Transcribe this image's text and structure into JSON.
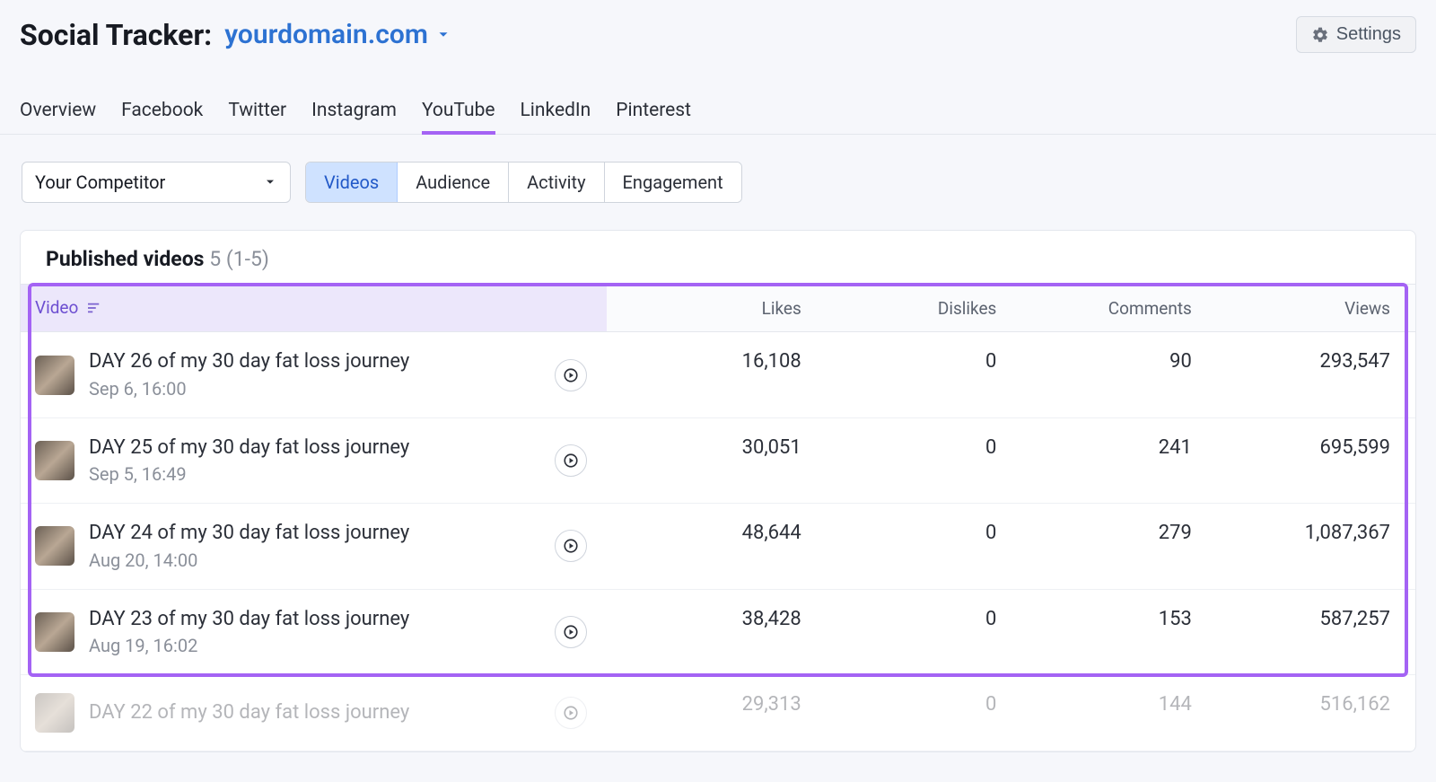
{
  "header": {
    "title_prefix": "Social Tracker:",
    "domain": "yourdomain.com",
    "settings_label": "Settings"
  },
  "tabs": {
    "items": [
      "Overview",
      "Facebook",
      "Twitter",
      "Instagram",
      "YouTube",
      "LinkedIn",
      "Pinterest"
    ],
    "active_index": 4
  },
  "controls": {
    "competitor_label": "Your Competitor",
    "segments": [
      "Videos",
      "Audience",
      "Activity",
      "Engagement"
    ],
    "active_segment_index": 0
  },
  "panel": {
    "title": "Published videos",
    "count_suffix": "5 (1-5)",
    "columns": {
      "video": "Video",
      "likes": "Likes",
      "dislikes": "Dislikes",
      "comments": "Comments",
      "views": "Views"
    },
    "highlight_rows": 4,
    "rows": [
      {
        "title": "DAY 26 of my 30 day fat loss journey",
        "date": "Sep 6, 16:00",
        "likes": "16,108",
        "dislikes": "0",
        "comments": "90",
        "views": "293,547"
      },
      {
        "title": "DAY 25 of my 30 day fat loss journey",
        "date": "Sep 5, 16:49",
        "likes": "30,051",
        "dislikes": "0",
        "comments": "241",
        "views": "695,599"
      },
      {
        "title": "DAY 24 of my 30 day fat loss journey",
        "date": "Aug 20, 14:00",
        "likes": "48,644",
        "dislikes": "0",
        "comments": "279",
        "views": "1,087,367"
      },
      {
        "title": "DAY 23 of my 30 day fat loss journey",
        "date": "Aug 19, 16:02",
        "likes": "38,428",
        "dislikes": "0",
        "comments": "153",
        "views": "587,257"
      },
      {
        "title": "DAY 22 of my 30 day fat loss journey",
        "date": "",
        "likes": "29,313",
        "dislikes": "0",
        "comments": "144",
        "views": "516,162"
      }
    ]
  }
}
